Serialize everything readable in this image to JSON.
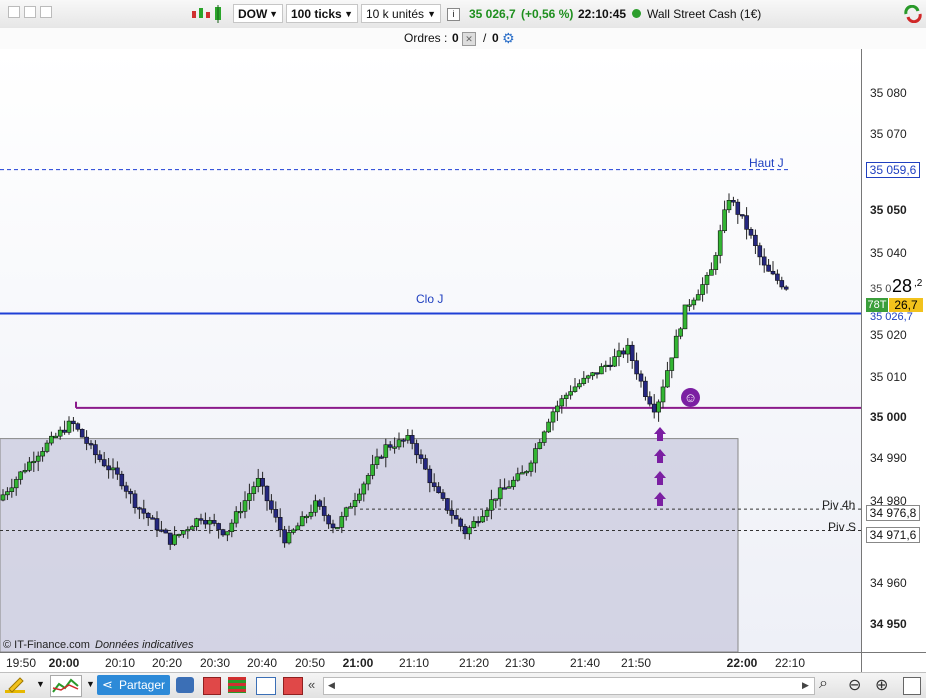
{
  "toolbar": {
    "window_buttons": [
      "minimize",
      "restore",
      "maximize"
    ],
    "instrument": "DOW",
    "period": "100 ticks",
    "size": "10 k unités",
    "price": "35 026,7",
    "change": "(+0,56 %)",
    "time": "22:10:45",
    "market_name": "Wall Street Cash (1€)"
  },
  "orders": {
    "label": "Ordres :",
    "count_a": "0",
    "sep": "/",
    "count_b": "0"
  },
  "levels": {
    "haut_j": {
      "label": "Haut J",
      "value": "35 059,6"
    },
    "clo_j": {
      "label": "Clo J"
    },
    "piv_4h": {
      "label": "Piv 4h",
      "value": "34 976,8"
    },
    "piv_s": {
      "label": "Piv S",
      "value": "34 971,6"
    }
  },
  "current_price": {
    "ticks": "78T",
    "big": "28",
    "sup": ",2",
    "small": "26,7",
    "under": "35 0",
    "under2": "35 026,7"
  },
  "yaxis_labels": [
    {
      "text": "35 080",
      "bold": false
    },
    {
      "text": "35 070",
      "bold": false
    },
    {
      "text": "35 050",
      "bold": true
    },
    {
      "text": "35 040",
      "bold": false
    },
    {
      "text": "35 020",
      "bold": false
    },
    {
      "text": "35 010",
      "bold": false
    },
    {
      "text": "35 000",
      "bold": true
    },
    {
      "text": "34 990",
      "bold": false
    },
    {
      "text": "34 980",
      "bold": false
    },
    {
      "text": "34 960",
      "bold": false
    },
    {
      "text": "34 950",
      "bold": true
    }
  ],
  "xaxis_labels": [
    {
      "text": "19:50",
      "bold": false
    },
    {
      "text": "20:00",
      "bold": true
    },
    {
      "text": "20:10",
      "bold": false
    },
    {
      "text": "20:20",
      "bold": false
    },
    {
      "text": "20:30",
      "bold": false
    },
    {
      "text": "20:40",
      "bold": false
    },
    {
      "text": "20:50",
      "bold": false
    },
    {
      "text": "21:00",
      "bold": true
    },
    {
      "text": "21:10",
      "bold": false
    },
    {
      "text": "21:20",
      "bold": false
    },
    {
      "text": "21:30",
      "bold": false
    },
    {
      "text": "21:40",
      "bold": false
    },
    {
      "text": "21:50",
      "bold": false
    },
    {
      "text": "22:00",
      "bold": true
    },
    {
      "text": "22:10",
      "bold": false
    }
  ],
  "copyright": "© IT-Finance.com",
  "disclaimer": "Données indicatives",
  "bottom": {
    "share_label": "Partager"
  },
  "colors": {
    "bull": "#33b533",
    "bear": "#25277f",
    "clo_line": "#1f3fd6",
    "pivot_line": "#8b1a8b",
    "rect": "#c9cade"
  }
}
